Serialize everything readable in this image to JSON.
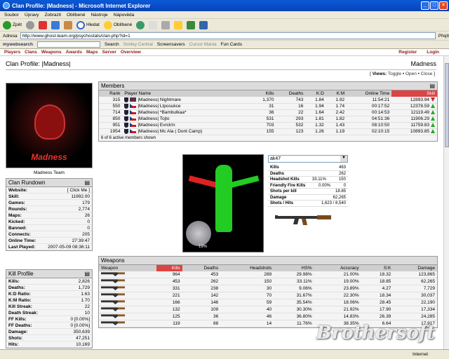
{
  "window": {
    "title": "Clan Profile: |Madness| - Microsoft Internet Explorer"
  },
  "menu": [
    "Soubor",
    "Úpravy",
    "Zobrazit",
    "Oblíbené",
    "Nástroje",
    "Nápověda"
  ],
  "toolbar": {
    "back": "Zpět",
    "search": "Hledat",
    "favorites": "Oblíbené"
  },
  "address": {
    "label": "Adresa",
    "url": "http://www.ghost-team.org/psychostats/clan.php?id=1",
    "go": "Přejít"
  },
  "links": {
    "brand": "mywebsearch",
    "search": "Search",
    "smiley": "Smiley Central",
    "screensavers": "Screensavers",
    "cursor": "Cursor Mania",
    "funcards": "Fun Cards"
  },
  "sitenav": {
    "items": [
      "Players",
      "Clans",
      "Weapons",
      "Awards",
      "Maps",
      "Server",
      "Overview"
    ],
    "register": "Register",
    "login": "Login"
  },
  "profile": {
    "title": "Clan Profile: |Madness|",
    "name": "Madness",
    "views_label": "Views:",
    "views": [
      "Toggle",
      "Open",
      "Close"
    ],
    "team_caption": "Madness Team",
    "logo_text": "Madness"
  },
  "rundown": {
    "title": "Clan Rundown",
    "rows": [
      {
        "k": "Website:",
        "v": "[ Click Me ]"
      },
      {
        "k": "Skill:",
        "v": "11992.00"
      },
      {
        "k": "Games:",
        "v": "179"
      },
      {
        "k": "Rounds:",
        "v": "2,774"
      },
      {
        "k": "Maps:",
        "v": "26"
      },
      {
        "k": "Kicked:",
        "v": "0"
      },
      {
        "k": "Banned:",
        "v": "0"
      },
      {
        "k": "Connects:",
        "v": "205"
      },
      {
        "k": "Online Time:",
        "v": "27:39:47"
      },
      {
        "k": "Last Played:",
        "v": "2007-05-09 08:36:11"
      }
    ]
  },
  "kill": {
    "title": "Kill Profile",
    "rows": [
      {
        "k": "Kills:",
        "v": "2,826"
      },
      {
        "k": "Deaths:",
        "v": "1,729"
      },
      {
        "k": "K:D Ratio:",
        "v": "1.63"
      },
      {
        "k": "K:M Ratio:",
        "v": "1.70"
      },
      {
        "k": "Kill Streak:",
        "v": "22"
      },
      {
        "k": "Death Streak:",
        "v": "10"
      },
      {
        "k": "FF Kills:",
        "v": "0 [0.00%]"
      },
      {
        "k": "FF Deaths:",
        "v": "0 [0.00%]"
      },
      {
        "k": "Damage:",
        "v": "350,639"
      },
      {
        "k": "Shots:",
        "v": "47,251"
      },
      {
        "k": "Hits:",
        "v": "10,169"
      }
    ]
  },
  "members": {
    "title": "Members",
    "headers": [
      "Rank",
      "Player Name",
      "Kills",
      "Deaths",
      "K:D",
      "K:M",
      "Online Time",
      "Skill"
    ],
    "rows": [
      {
        "rank": "315",
        "flag": "uk",
        "name": "|Madness| Nightmare",
        "kills": "1,370",
        "deaths": "743",
        "kd": "1.84",
        "km": "1.92",
        "time": "11:54:21",
        "skill": "12893.94",
        "trend": "down"
      },
      {
        "rank": "550",
        "flag": "cz",
        "name": "|Madness| Ltposukce",
        "kills": "31",
        "deaths": "16",
        "kd": "1.94",
        "km": "1.74",
        "time": "00:17:52",
        "skill": "12378.59",
        "trend": "up"
      },
      {
        "rank": "714",
        "flag": "cz",
        "name": "|Madness| *Bambulkaa*",
        "kills": "36",
        "deaths": "22",
        "kd": "1.64",
        "km": "2.42",
        "time": "00:14:53",
        "skill": "12119.49",
        "trend": "up"
      },
      {
        "rank": "850",
        "flag": "cz",
        "name": "|Madness| Tojto",
        "kills": "531",
        "deaths": "293",
        "kd": "1.81",
        "km": "1.82",
        "time": "04:51:36",
        "skill": "11906.29",
        "trend": "up"
      },
      {
        "rank": "951",
        "flag": "cz",
        "name": "|Madness| Evrck!n",
        "kills": "703",
        "kd": "1.32",
        "deaths": "532",
        "km": "1.43",
        "time": "08:10:50",
        "skill": "11759.83",
        "trend": "up"
      },
      {
        "rank": "1954",
        "flag": "cz",
        "name": "|Madness| Mc Ala ( Dont Camp)",
        "kills": "155",
        "deaths": "123",
        "kd": "1.26",
        "km": "1.19",
        "time": "02:10:15",
        "skill": "10893.85",
        "trend": "up"
      }
    ],
    "footer": "6 of 6 active members shown"
  },
  "weaponstats": {
    "selected": "ak47",
    "rows": [
      {
        "k": "Kills",
        "v": "463"
      },
      {
        "k": "Deaths",
        "v": "262"
      },
      {
        "k": "Headshot Kills",
        "m": "33.11%",
        "v": "150"
      },
      {
        "k": "Friendly Fire Kills",
        "m": "0.00%",
        "v": "0"
      },
      {
        "k": "Shots per kill",
        "v": "18.85"
      },
      {
        "k": "Damage",
        "v": "62,265"
      },
      {
        "k": "Shots / Hits",
        "v": "1,623 / 8,540"
      }
    ]
  },
  "model": {
    "pct": "19%"
  },
  "weapons": {
    "title": "Weapons",
    "headers": [
      "Weapon",
      "Kills",
      "Deaths",
      "Headshots",
      "HS%",
      "Accuracy",
      "S:K",
      "Damage"
    ],
    "rows": [
      [
        "964",
        "453",
        "289",
        "29.98%",
        "21.00%",
        "18.32",
        "123,865"
      ],
      [
        "453",
        "262",
        "150",
        "33.11%",
        "19.00%",
        "18.85",
        "62,265"
      ],
      [
        "331",
        "238",
        "30",
        "9.06%",
        "23.89%",
        "4.27",
        "7,729"
      ],
      [
        "221",
        "142",
        "70",
        "31.67%",
        "22.30%",
        "18.34",
        "30,037"
      ],
      [
        "166",
        "146",
        "59",
        "35.54%",
        "18.06%",
        "28.45",
        "22,190"
      ],
      [
        "132",
        "109",
        "40",
        "30.30%",
        "21.92%",
        "17.90",
        "17,334"
      ],
      [
        "125",
        "36",
        "46",
        "36.80%",
        "14.83%",
        "26.39",
        "24,285"
      ],
      [
        "119",
        "88",
        "14",
        "11.76%",
        "38.35%",
        "6.64",
        "17,917"
      ]
    ]
  },
  "status": {
    "left": "",
    "zone": "Internet"
  },
  "watermark": "Brothersoft"
}
